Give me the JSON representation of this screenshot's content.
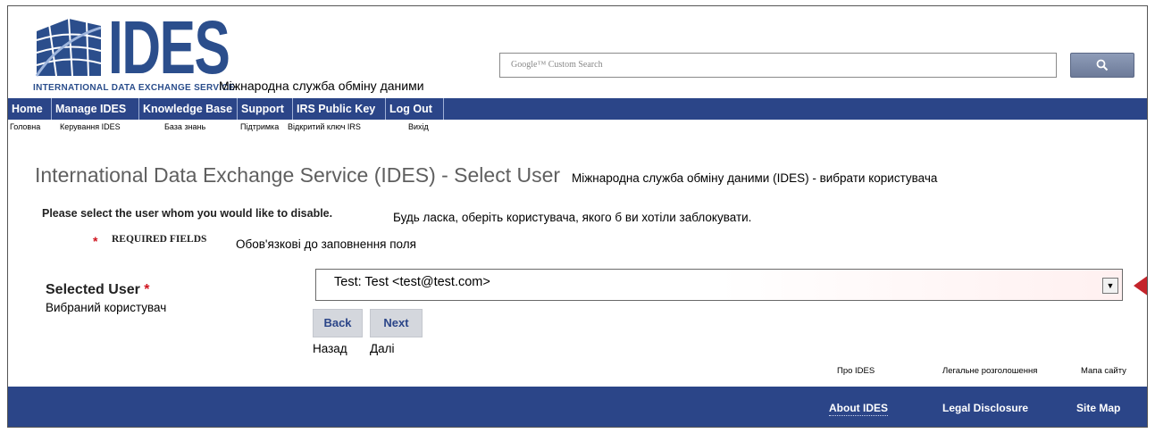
{
  "logo": {
    "text": "IDES",
    "subtitle": "INTERNATIONAL DATA EXCHANGE SERVICE",
    "subtitle_uk": "Міжнародна служба обміну даними"
  },
  "search": {
    "placeholder": "Google™ Custom Search",
    "button_icon": "search-icon"
  },
  "nav": {
    "items": [
      {
        "label": "Home",
        "uk": "Головна"
      },
      {
        "label": "Manage IDES",
        "uk": "Керування IDES"
      },
      {
        "label": "Knowledge Base",
        "uk": "База знань"
      },
      {
        "label": "Support",
        "uk": "Підтримка"
      },
      {
        "label": "IRS Public Key",
        "uk": "Відкритий ключ IRS"
      },
      {
        "label": "Log Out",
        "uk": "Вихід"
      }
    ]
  },
  "page": {
    "title": "International Data Exchange Service (IDES) - Select User",
    "title_uk": "Міжнародна служба обміну даними (IDES) - вибрати користувача",
    "instruction": "Please select the user whom you would like to disable.",
    "instruction_uk": "Будь ласка, оберіть користувача, якого б ви хотіли заблокувати.",
    "required_star": "*",
    "required_label": "REQUIRED FIELDS",
    "required_uk": "Обов'язкові до заповнення поля"
  },
  "form": {
    "selected_user_label": "Selected User",
    "selected_user_star": "*",
    "selected_user_uk": "Вибраний користувач",
    "selected_user_value": "Test: Test <test@test.com>",
    "back_label": "Back",
    "back_uk": "Назад",
    "next_label": "Next",
    "next_uk": "Далі"
  },
  "footer": {
    "links": [
      {
        "label": "About IDES",
        "uk": "Про IDES"
      },
      {
        "label": "Legal Disclosure",
        "uk": "Легальне розголошення"
      },
      {
        "label": "Site Map",
        "uk": "Мапа сайту"
      }
    ]
  },
  "colors": {
    "nav_bg": "#2b4588",
    "brand_blue": "#2b4e8c",
    "required_red": "#d0141e",
    "arrow_red": "#c4242b"
  }
}
